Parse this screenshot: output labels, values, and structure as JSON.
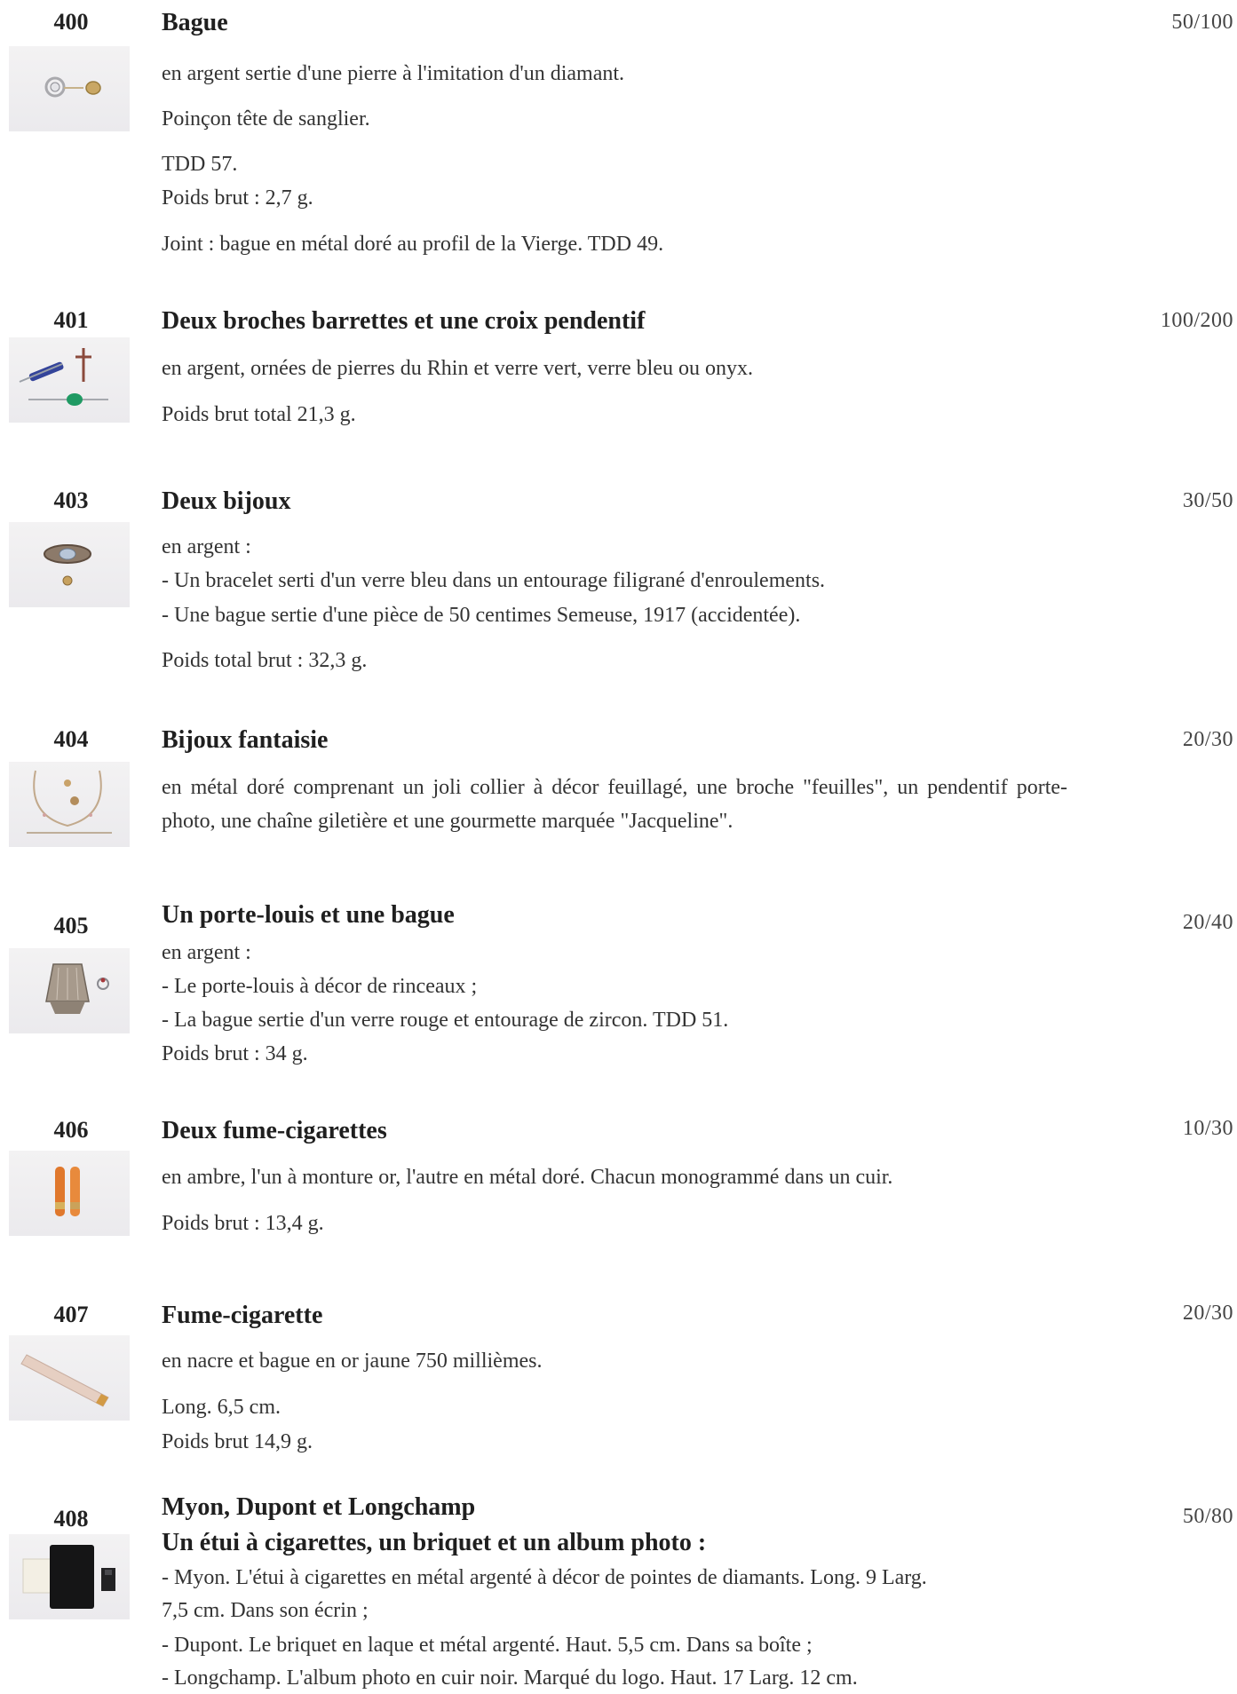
{
  "lots": [
    {
      "number": "400",
      "title": "Bague",
      "estimate": "50/100",
      "image": "ring-photo",
      "lines": [
        "en argent sertie d'une pierre à l'imitation d'un diamant.",
        "Poinçon tête de sanglier.",
        "TDD 57.",
        "Poids brut : 2,7 g.",
        "Joint : bague en métal doré au profil de la Vierge. TDD 49."
      ]
    },
    {
      "number": "401",
      "title": "Deux broches barrettes et une croix pendentif",
      "estimate": "100/200",
      "image": "brooches-cross-photo",
      "lines": [
        "en argent, ornées de pierres du Rhin et verre vert, verre bleu ou onyx.",
        "Poids brut total 21,3 g."
      ]
    },
    {
      "number": "403",
      "title": "Deux bijoux",
      "estimate": "30/50",
      "image": "bracelet-ring-photo",
      "lines": [
        "en argent :",
        "- Un bracelet serti d'un verre bleu dans un entourage filigrané d'enroulements.",
        "- Une bague sertie d'une pièce de 50 centimes Semeuse, 1917 (accidentée).",
        "Poids total brut : 32,3 g."
      ]
    },
    {
      "number": "404",
      "title": "Bijoux fantaisie",
      "estimate": "20/30",
      "image": "costume-jewelry-photo",
      "paragraph": "en métal doré comprenant un joli collier à décor feuillagé, une broche \"feuilles\", un pendentif porte-photo, une chaîne giletière et une gourmette marquée \"Jacqueline\"."
    },
    {
      "number": "405",
      "title": "Un porte-louis et une bague",
      "estimate": "20/40",
      "image": "coin-purse-ring-photo",
      "lines": [
        "en argent :",
        "- Le porte-louis à décor de rinceaux ;",
        "- La bague sertie d'un verre rouge et entourage de zircon. TDD 51.",
        "Poids brut : 34 g."
      ]
    },
    {
      "number": "406",
      "title": "Deux fume-cigarettes",
      "estimate": "10/30",
      "image": "amber-cigarette-holders-photo",
      "lines": [
        "en ambre, l'un à monture or, l'autre en métal doré. Chacun monogrammé dans un cuir.",
        "Poids brut : 13,4 g."
      ]
    },
    {
      "number": "407",
      "title": "Fume-cigarette",
      "estimate": "20/30",
      "image": "nacre-cigarette-holder-photo",
      "lines": [
        "en nacre et bague en or jaune 750 millièmes.",
        "Long. 6,5 cm.",
        "Poids brut 14,9 g."
      ]
    },
    {
      "number": "408",
      "title": "Myon, Dupont et Longchamp",
      "subtitle": "Un étui à cigarettes, un briquet et un album photo :",
      "estimate": "50/80",
      "image": "case-lighter-album-photo",
      "lines": [
        "- Myon. L'étui à cigarettes en métal argenté à décor de pointes de diamants. Long. 9 Larg.",
        "7,5 cm. Dans son écrin ;",
        "- Dupont. Le briquet en laque et métal argenté. Haut. 5,5 cm. Dans sa boîte ;",
        "- Longchamp. L'album photo en cuir noir. Marqué du logo. Haut. 17 Larg. 12 cm."
      ]
    }
  ]
}
